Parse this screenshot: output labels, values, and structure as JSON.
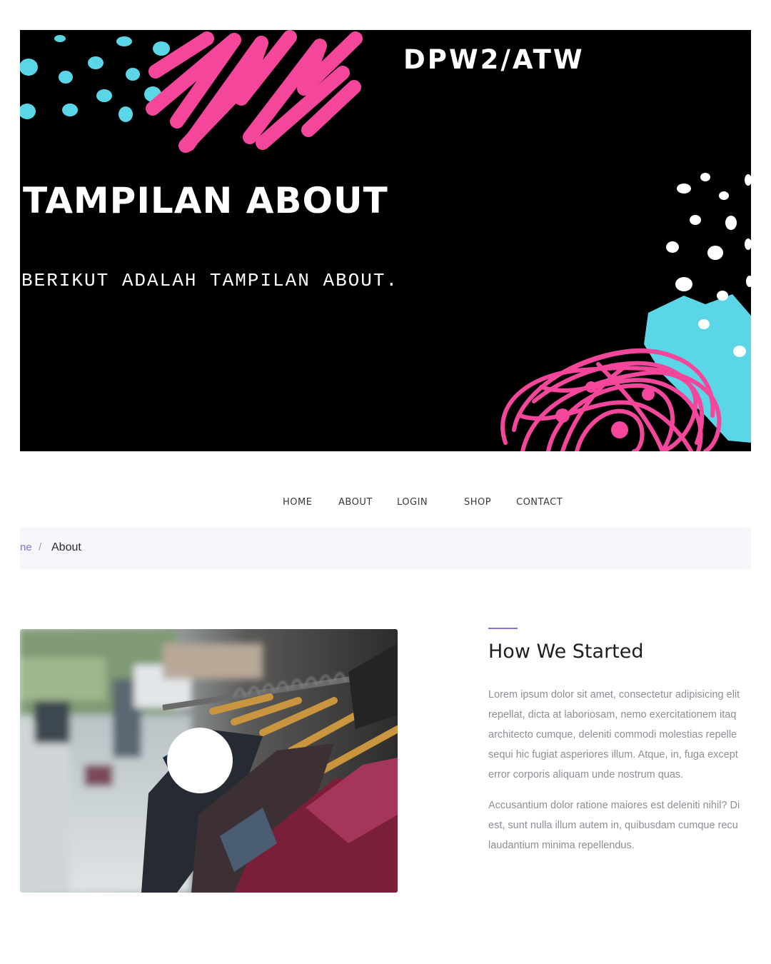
{
  "hero": {
    "brand": "DPW2/ATW",
    "title": "TAMPILAN ABOUT",
    "subtitle": "BERIKUT ADALAH TAMPILAN ABOUT.",
    "colors": {
      "background": "#000000",
      "pink": "#f4479b",
      "cyan": "#5ad6e6",
      "white": "#ffffff"
    }
  },
  "nav": {
    "items": [
      {
        "label": "HOME"
      },
      {
        "label": "ABOUT"
      },
      {
        "label": "LOGIN"
      },
      {
        "label": "SHOP"
      },
      {
        "label": "CONTACT"
      }
    ]
  },
  "breadcrumb": {
    "home_label": "ne",
    "separator": "/",
    "current": "About",
    "link_color": "#7b74e0"
  },
  "about": {
    "title": "How We Started",
    "accent_color": "#7b74e0",
    "paragraph1_lines": [
      "Lorem ipsum dolor sit amet, consectetur adipisicing elit",
      "repellat, dicta at laboriosam, nemo exercitationem itaq",
      "architecto cumque, deleniti commodi molestias repelle",
      "sequi hic fugiat asperiores illum. Atque, in, fuga except",
      "error corporis aliquam unde nostrum quas."
    ],
    "paragraph2_lines": [
      "Accusantium dolor ratione maiores est deleniti nihil? Di",
      "est, sunt nulla illum autem in, quibusdam cumque recu",
      "laudantium minima repellendus."
    ]
  },
  "photo": {
    "subject": "clothing-rack-photo",
    "play_icon": "circle-play-icon"
  }
}
